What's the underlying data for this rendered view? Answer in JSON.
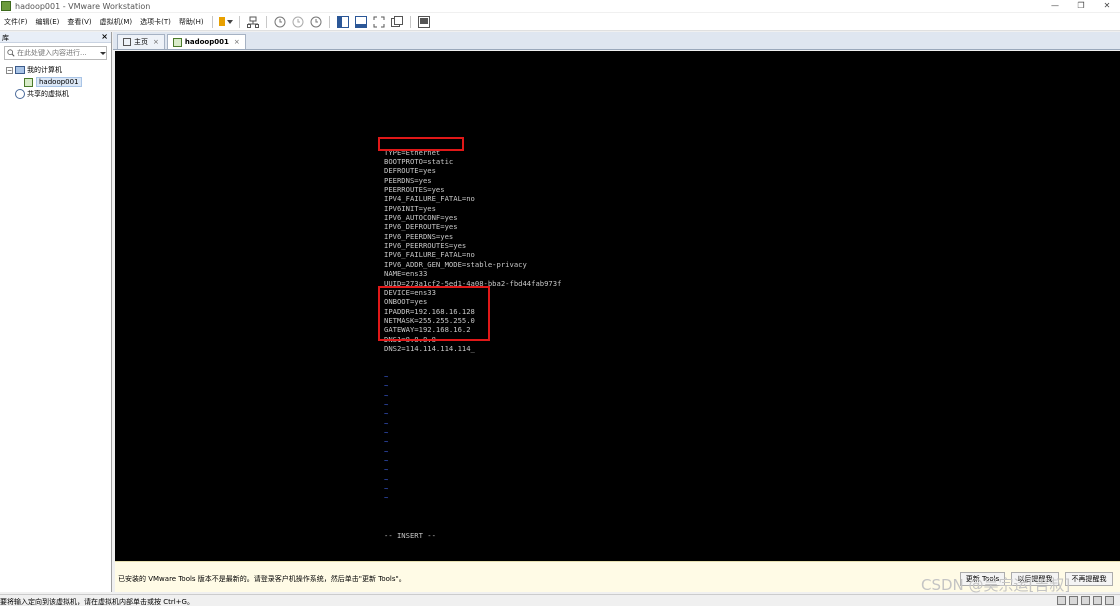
{
  "window": {
    "title": "hadoop001 - VMware Workstation",
    "minimize": "—",
    "restore": "❐",
    "close": "✕"
  },
  "menu": {
    "items": [
      "文件(F)",
      "编辑(E)",
      "查看(V)",
      "虚拟机(M)",
      "选项卡(T)",
      "帮助(H)"
    ]
  },
  "sidebar": {
    "title": "库",
    "close": "×",
    "search_placeholder": "在此处键入内容进行...",
    "tree": {
      "my_computer": "我的计算机",
      "vm": "hadoop001",
      "shared": "共享的虚拟机"
    }
  },
  "tabs": [
    {
      "label": "主页",
      "close": "×"
    },
    {
      "label": "hadoop001",
      "close": "×"
    }
  ],
  "terminal": {
    "lines": [
      "TYPE=Ethernet",
      "BOOTPROTO=static",
      "DEFROUTE=yes",
      "PEERDNS=yes",
      "PEERROUTES=yes",
      "IPV4_FAILURE_FATAL=no",
      "IPV6INIT=yes",
      "IPV6_AUTOCONF=yes",
      "IPV6_DEFROUTE=yes",
      "IPV6_PEERDNS=yes",
      "IPV6_PEERROUTES=yes",
      "IPV6_FAILURE_FATAL=no",
      "IPV6_ADDR_GEN_MODE=stable-privacy",
      "NAME=ens33",
      "UUID=273a1cf2-5ed1-4a08-bba2-fbd44fab973f",
      "DEVICE=ens33",
      "ONBOOT=yes",
      "IPADDR=192.168.16.128",
      "NETMASK=255.255.255.0",
      "GATEWAY=192.168.16.2",
      "DNS1=8.8.8.8",
      "DNS2=114.114.114.114_"
    ],
    "tilde": "~",
    "tilde_count": 14,
    "mode": "-- INSERT --"
  },
  "notification": {
    "message": "已安装的 VMware Tools 版本不是最新的。请登录客户机操作系统，然后单击\"更新 Tools\"。",
    "update_button": "更新 Tools",
    "remind_button": "以后提醒我",
    "never_button": "不再提醒我"
  },
  "watermark": "CSDN @吴宗运[吉叔]",
  "status": {
    "text": "要将输入定向到该虚拟机，请在虚拟机内部单击或按 Ctrl+G。"
  },
  "colors": {
    "highlight": "#e01818",
    "tilde": "#3b5bd6",
    "terminal_text": "#c8c8c8"
  }
}
